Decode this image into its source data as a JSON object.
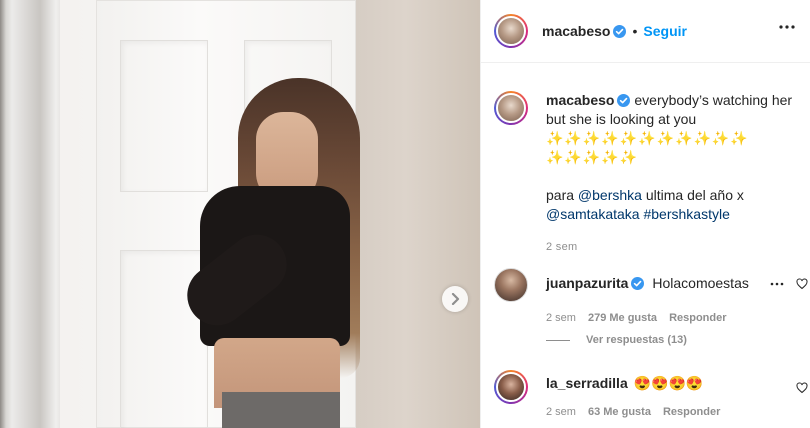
{
  "post": {
    "username": "macabeso",
    "follow_label": "Seguir",
    "dot": "•"
  },
  "caption": {
    "username": "macabeso",
    "line1": "everybody’s watching her but she is looking at you",
    "sparkles1": "✨✨✨✨✨✨✨✨✨✨✨",
    "sparkles2": "✨✨✨✨✨",
    "para_prefix": "para",
    "mention1": "@bershka",
    "para_mid": "ultima del año x",
    "mention2": "@samtakataka",
    "hashtag": "#bershkastyle",
    "time": "2 sem"
  },
  "comments": [
    {
      "username": "juanpazurita",
      "text": "Holacomoestas",
      "time": "2 sem",
      "likes": "279 Me gusta",
      "reply": "Responder"
    },
    {
      "username": "la_serradilla",
      "text": "😍😍😍😍",
      "time": "2 sem",
      "likes": "63 Me gusta",
      "reply": "Responder"
    }
  ],
  "view_replies": "Ver respuestas (13)",
  "icons": {
    "verified": "verified-badge-icon",
    "more": "more-options-icon",
    "heart": "heart-icon",
    "arrow": "chevron-right-icon"
  },
  "colors": {
    "accent": "#0095f6",
    "link": "#00376b",
    "muted": "#8e8e8e",
    "verified": "#3897f0"
  }
}
